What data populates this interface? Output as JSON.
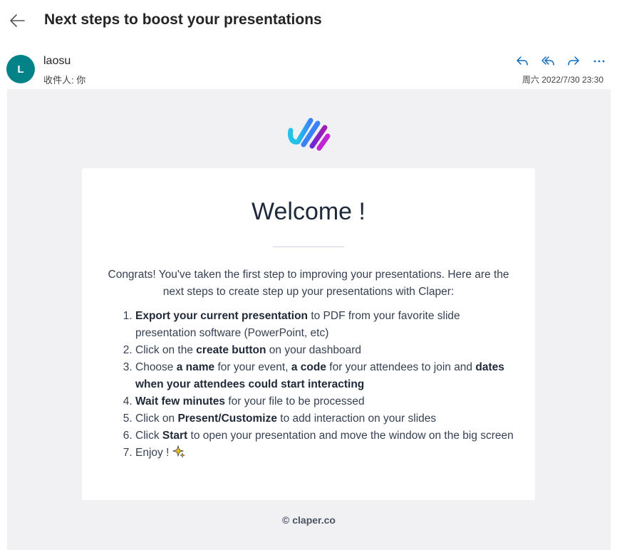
{
  "header": {
    "back_icon": "arrow-left-icon",
    "subject": "Next steps to boost your presentations"
  },
  "sender": {
    "avatar_initial": "L",
    "avatar_color": "#038387",
    "name": "laosu",
    "recipient_line": "收件人: 你",
    "timestamp": "周六 2022/7/30 23:30",
    "actions": [
      "reply-icon",
      "reply-all-icon",
      "forward-icon",
      "more-icon"
    ],
    "accent_color": "#0f6cbd"
  },
  "email": {
    "logo": "claper-logo",
    "heading": "Welcome !",
    "intro": "Congrats! You've taken the first step to improving your presentations. Here are the next steps to create step up your presentations with Claper:",
    "steps": [
      {
        "bold": "Export your current presentation",
        "text": " to PDF from your favorite slide presentation software (PowerPoint, etc)"
      },
      {
        "pre": "Click on the ",
        "bold": "create button",
        "text": " on your dashboard"
      },
      {
        "pre": "Choose ",
        "bold": "a name",
        "mid": " for your event, ",
        "bold2": "a code",
        "mid2": " for your attendees to join and ",
        "bold3": "dates when your attendees could start interacting"
      },
      {
        "bold": "Wait few minutes",
        "text": " for your file to be processed"
      },
      {
        "pre": "Click on ",
        "bold": "Present/Customize",
        "text": " to add interaction on your slides"
      },
      {
        "pre": "Click ",
        "bold": "Start",
        "text": " to open your presentation and move the window on the big screen"
      },
      {
        "pre": "Enjoy ! ",
        "emoji": "sparkles-icon"
      }
    ],
    "footer": "© claper.co"
  }
}
